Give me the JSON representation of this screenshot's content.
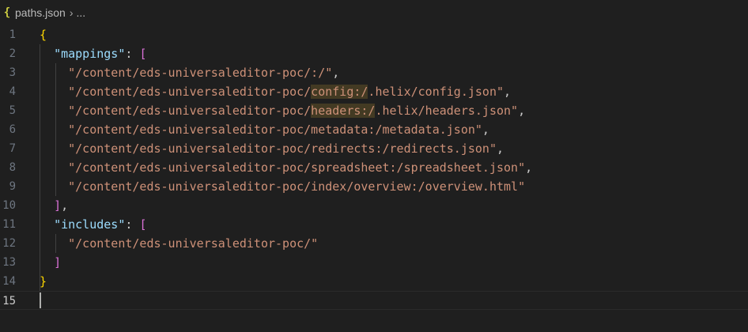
{
  "breadcrumb": {
    "file_icon_glyph": "{",
    "file_name": "paths.json",
    "separator_glyph": "›",
    "more": "..."
  },
  "editor": {
    "active_line": "15",
    "lines": [
      {
        "number": "1",
        "parts": [
          {
            "t": "{",
            "c": "p-yellow"
          }
        ]
      },
      {
        "number": "2",
        "parts": [
          {
            "t": "  "
          },
          {
            "t": "\"mappings\"",
            "c": "key"
          },
          {
            "t": ": "
          },
          {
            "t": "[",
            "c": "p-pink"
          }
        ]
      },
      {
        "number": "3",
        "parts": [
          {
            "t": "    "
          },
          {
            "t": "\"/content/eds-universaleditor-poc/:/\"",
            "c": "str"
          },
          {
            "t": ","
          }
        ]
      },
      {
        "number": "4",
        "parts": [
          {
            "t": "    "
          },
          {
            "t": "\"/content/eds-universaleditor-poc/",
            "c": "str"
          },
          {
            "t": "config:/",
            "c": "hl"
          },
          {
            "t": ".helix/config.json\"",
            "c": "str"
          },
          {
            "t": ","
          }
        ]
      },
      {
        "number": "5",
        "parts": [
          {
            "t": "    "
          },
          {
            "t": "\"/content/eds-universaleditor-poc/",
            "c": "str"
          },
          {
            "t": "headers:/",
            "c": "hl"
          },
          {
            "t": ".helix/headers.json\"",
            "c": "str"
          },
          {
            "t": ","
          }
        ]
      },
      {
        "number": "6",
        "parts": [
          {
            "t": "    "
          },
          {
            "t": "\"/content/eds-universaleditor-poc/metadata:/metadata.json\"",
            "c": "str"
          },
          {
            "t": ","
          }
        ]
      },
      {
        "number": "7",
        "parts": [
          {
            "t": "    "
          },
          {
            "t": "\"/content/eds-universaleditor-poc/redirects:/redirects.json\"",
            "c": "str"
          },
          {
            "t": ","
          }
        ]
      },
      {
        "number": "8",
        "parts": [
          {
            "t": "    "
          },
          {
            "t": "\"/content/eds-universaleditor-poc/spreadsheet:/spreadsheet.json\"",
            "c": "str"
          },
          {
            "t": ","
          }
        ]
      },
      {
        "number": "9",
        "parts": [
          {
            "t": "    "
          },
          {
            "t": "\"/content/eds-universaleditor-poc/index/overview:/overview.html\"",
            "c": "str"
          }
        ]
      },
      {
        "number": "10",
        "parts": [
          {
            "t": "  "
          },
          {
            "t": "]",
            "c": "p-pink"
          },
          {
            "t": ","
          }
        ]
      },
      {
        "number": "11",
        "parts": [
          {
            "t": "  "
          },
          {
            "t": "\"includes\"",
            "c": "key"
          },
          {
            "t": ": "
          },
          {
            "t": "[",
            "c": "p-pink"
          }
        ]
      },
      {
        "number": "12",
        "parts": [
          {
            "t": "    "
          },
          {
            "t": "\"/content/eds-universaleditor-poc/\"",
            "c": "str"
          }
        ]
      },
      {
        "number": "13",
        "parts": [
          {
            "t": "  "
          },
          {
            "t": "]",
            "c": "p-pink"
          }
        ]
      },
      {
        "number": "14",
        "parts": [
          {
            "t": "}",
            "c": "p-yellow"
          }
        ]
      },
      {
        "number": "15",
        "parts": []
      }
    ]
  },
  "colors": {
    "background": "#1f1f1f",
    "key": "#9cdcfe",
    "string": "#ce9178",
    "bracket_level1": "#ffd700",
    "bracket_level2": "#da70d6",
    "line_number": "#6e7681",
    "line_number_active": "#cccccc"
  }
}
